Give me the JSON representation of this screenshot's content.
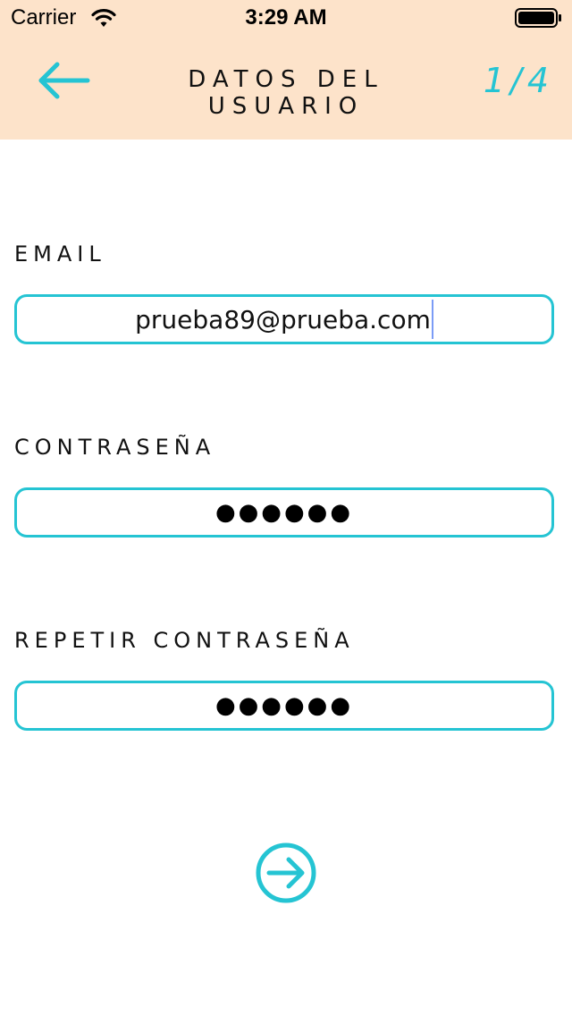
{
  "status_bar": {
    "carrier": "Carrier",
    "time": "3:29 AM",
    "wifi_icon": "wifi-icon",
    "battery_icon": "battery-icon"
  },
  "header": {
    "title": "DATOS DEL USUARIO",
    "step": "1/4",
    "back_icon": "arrow-left-icon",
    "background_color": "#fde3ca",
    "accent_color": "#25c4d3"
  },
  "form": {
    "email": {
      "label": "EMAIL",
      "value": "prueba89@prueba.com"
    },
    "password": {
      "label": "CONTRASEÑA",
      "value": "●●●●●●"
    },
    "repeat_password": {
      "label": "REPETIR CONTRASEÑA",
      "value": "●●●●●●"
    },
    "next_icon": "arrow-right-circle-icon"
  }
}
